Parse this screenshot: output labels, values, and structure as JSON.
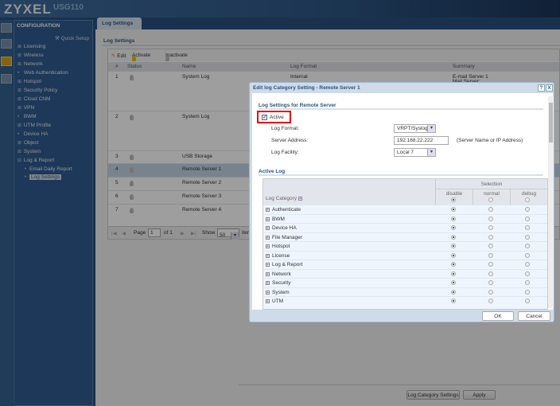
{
  "header": {
    "brand": "ZYXEL",
    "model": "USG110"
  },
  "sidebar": {
    "title": "CONFIGURATION",
    "quick_setup": "Quick Setup",
    "items": [
      {
        "label": "Licensing",
        "type": "expand"
      },
      {
        "label": "Wireless",
        "type": "expand"
      },
      {
        "label": "Network",
        "type": "expand"
      },
      {
        "label": "Web Authentication",
        "type": "leaf"
      },
      {
        "label": "Hotspot",
        "type": "expand"
      },
      {
        "label": "Security Policy",
        "type": "expand"
      },
      {
        "label": "Cloud CNM",
        "type": "expand"
      },
      {
        "label": "VPN",
        "type": "expand"
      },
      {
        "label": "BWM",
        "type": "leaf"
      },
      {
        "label": "UTM Profile",
        "type": "expand"
      },
      {
        "label": "Device HA",
        "type": "leaf"
      },
      {
        "label": "Object",
        "type": "expand"
      },
      {
        "label": "System",
        "type": "expand"
      },
      {
        "label": "Log & Report",
        "type": "collapse"
      }
    ],
    "subitems": [
      {
        "label": "Email Daily Report"
      },
      {
        "label": "Log Settings",
        "selected": true
      }
    ]
  },
  "main": {
    "tab": "Log Settings",
    "section_title": "Log Settings",
    "toolbar": {
      "edit": "Edit",
      "activate": "Activate",
      "inactivate": "Inactivate"
    },
    "columns": [
      "#",
      "Status",
      "Name",
      "Log Format",
      "Summary"
    ],
    "rows": [
      {
        "num": "1",
        "name": "System Log",
        "format": "Internal",
        "summary": "E-mail Server 1",
        "summary2": "Mail Server:"
      },
      {
        "num": "2",
        "name": "System Log",
        "format": "",
        "summary": ""
      },
      {
        "num": "3",
        "name": "USB Storage",
        "format": "",
        "summary": ""
      },
      {
        "num": "4",
        "name": "Remote Server 1",
        "format": "",
        "summary": "",
        "selected": true
      },
      {
        "num": "5",
        "name": "Remote Server 2",
        "format": "",
        "summary": ""
      },
      {
        "num": "6",
        "name": "Remote Server 3",
        "format": "",
        "summary": ""
      },
      {
        "num": "7",
        "name": "Remote Server 4",
        "format": "",
        "summary": ""
      }
    ],
    "pager": {
      "page_label": "Page",
      "page": "1",
      "of": "of 1",
      "show_label": "Show",
      "show": "50",
      "items": "items"
    },
    "buttons": {
      "log_category_settings": "Log Category Settings",
      "apply": "Apply"
    }
  },
  "dialog": {
    "title": "Edit log Category Setting - Remote Server 1",
    "help": "?",
    "close": "X",
    "section1": "Log Settings for Remote Server",
    "active_label": "Active",
    "active": true,
    "log_format_label": "Log Format:",
    "log_format": "VRPT/Syslog",
    "server_address_label": "Server Address:",
    "server_address": "192.168.22.222",
    "server_hint": "(Server Name or IP Address)",
    "log_facility_label": "Log Facility:",
    "log_facility": "Local 7",
    "section2": "Active Log",
    "table": {
      "category_header": "Log Category",
      "selection_header": "Selection",
      "levels": [
        "disable",
        "normal",
        "debug"
      ],
      "header_selected": "disable",
      "rows": [
        {
          "name": "Authenticate",
          "level": "disable"
        },
        {
          "name": "BWM",
          "level": "disable"
        },
        {
          "name": "Device HA",
          "level": "disable"
        },
        {
          "name": "File Manager",
          "level": "disable"
        },
        {
          "name": "Hotspot",
          "level": "disable"
        },
        {
          "name": "License",
          "level": "disable"
        },
        {
          "name": "Log & Report",
          "level": "disable"
        },
        {
          "name": "Network",
          "level": "disable"
        },
        {
          "name": "Security",
          "level": "disable"
        },
        {
          "name": "System",
          "level": "disable"
        },
        {
          "name": "UTM",
          "level": "disable"
        }
      ]
    },
    "ok": "OK",
    "cancel": "Cancel"
  }
}
